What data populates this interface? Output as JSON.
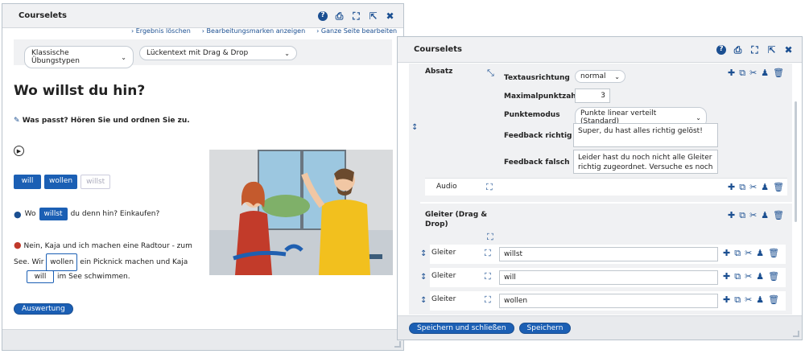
{
  "left": {
    "title": "Courselets",
    "links": [
      "Ergebnis löschen",
      "Bearbeitungsmarken anzeigen",
      "Ganze Seite bearbeiten"
    ],
    "select1": "Klassische Übungstypen",
    "select2": "Lückentext mit Drag & Drop",
    "heading": "Wo willst du hin?",
    "instruction": "Was passt? Hören Sie und ordnen Sie zu.",
    "chips": [
      "will",
      "wollen",
      "willst"
    ],
    "line1_before": "Wo",
    "line1_gap": "willst",
    "line1_after": "du denn hin? Einkaufen?",
    "line2_a": "Nein, Kaja und ich machen eine Radtour - zum",
    "line2_b": "See. Wir",
    "line2_gap": "wollen",
    "line2_c": "ein Picknick machen und Kaja",
    "line3_gap": "will",
    "line3_after": "im See schwimmen.",
    "button": "Auswertung"
  },
  "right": {
    "title": "Courselets",
    "absatz": "Absatz",
    "fields": {
      "textausrichtung_label": "Textausrichtung",
      "textausrichtung_value": "normal",
      "maximalpunktzahl_label": "Maximalpunktzahl",
      "maximalpunktzahl_value": "3",
      "punktemodus_label": "Punktemodus",
      "punktemodus_value": "Punkte linear verteilt (Standard)",
      "feedback_richtig_label": "Feedback richtig",
      "feedback_richtig_value": "Super, du hast alles richtig gelöst!",
      "feedback_falsch_label": "Feedback falsch",
      "feedback_falsch_value": "Leider hast du noch nicht alle Gleiter richtig zugeordnet. Versuche es noch"
    },
    "audio": "Audio",
    "gleiter_group": "Gleiter (Drag & Drop)",
    "gleiter_label": "Gleiter",
    "gleiter_values": [
      "willst",
      "will",
      "wollen"
    ],
    "save_close": "Speichern und schließen",
    "save": "Speichern"
  }
}
